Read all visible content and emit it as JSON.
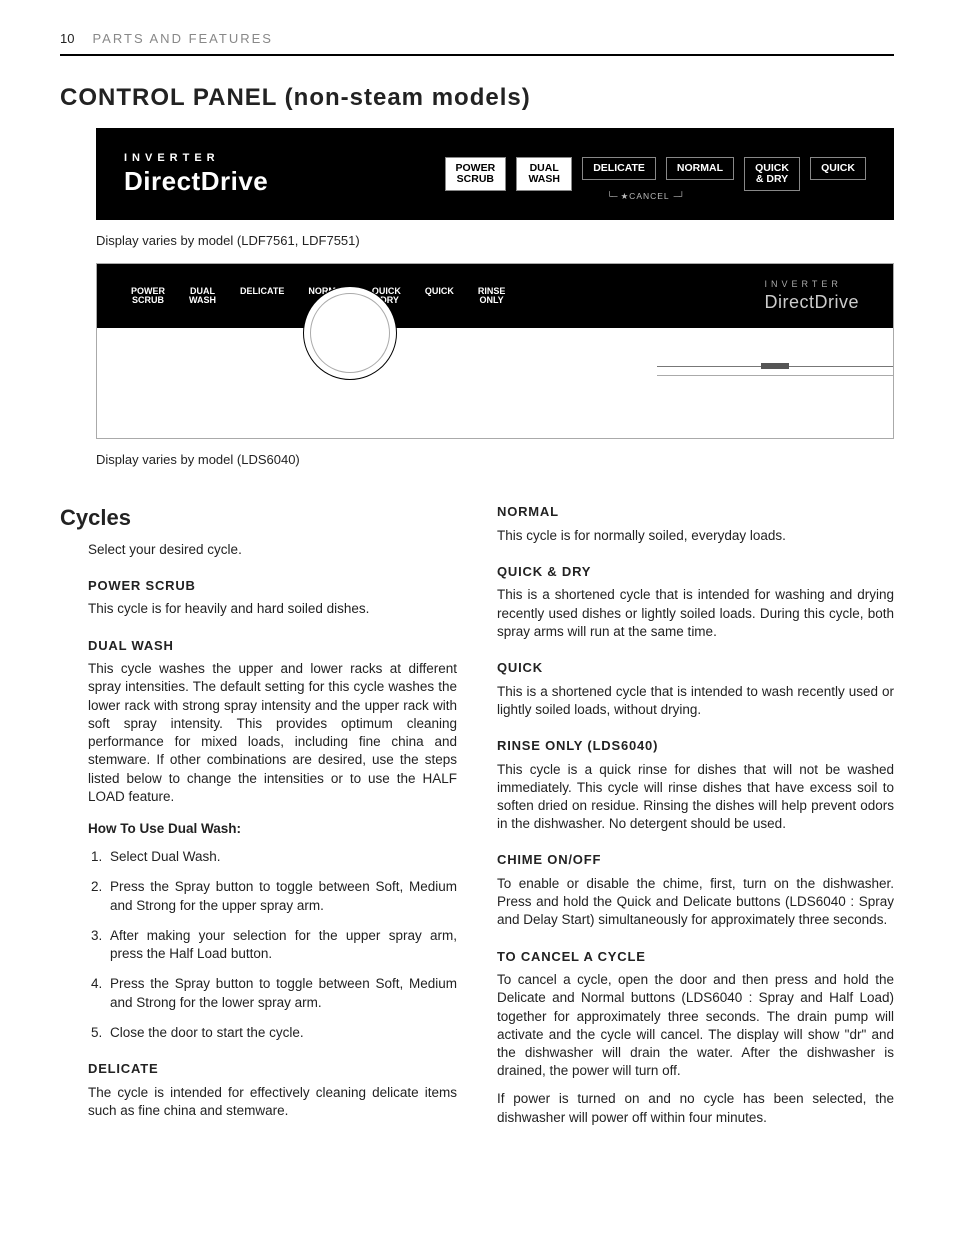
{
  "header": {
    "page": "10",
    "section": "PARTS AND FEATURES"
  },
  "title": "CONTROL PANEL (non-steam models)",
  "panel1": {
    "brand_top": "INVERTER",
    "brand_main": "DirectDrive",
    "buttons": {
      "b1a": "POWER",
      "b1b": "SCRUB",
      "b2a": "DUAL",
      "b2b": "WASH",
      "b3": "DELICATE",
      "b4": "NORMAL",
      "b5a": "QUICK",
      "b5b": "& DRY",
      "b6": "QUICK"
    },
    "cancel": "★CANCEL"
  },
  "caption1": "Display varies by model (LDF7561, LDF7551)",
  "panel2": {
    "labels": {
      "l1a": "POWER",
      "l1b": "SCRUB",
      "l2a": "DUAL",
      "l2b": "WASH",
      "l3": "DELICATE",
      "l4": "NORMAL",
      "l5a": "QUICK",
      "l5b": "&DRY",
      "l6": "QUICK",
      "l7a": "RINSE",
      "l7b": "ONLY"
    },
    "brand_top": "INVERTER",
    "brand_main": "DirectDrive"
  },
  "caption2": "Display varies by model (LDS6040)",
  "left": {
    "cycles_title": "Cycles",
    "intro": "Select your desired cycle.",
    "power_scrub_h": "POWER SCRUB",
    "power_scrub_p": "This cycle is for heavily and hard soiled dishes.",
    "dual_wash_h": "DUAL WASH",
    "dual_wash_p": "This cycle washes the upper and lower racks at different spray intensities. The default setting for this cycle washes the lower rack with strong spray intensity and the upper rack with soft spray intensity. This provides optimum cleaning performance for mixed loads, including fine china and stemware. If other combinations are desired, use the steps listed below to change the intensities or to use the HALF LOAD feature.",
    "howto_h": "How To Use Dual Wash:",
    "steps": {
      "s1": "Select Dual Wash.",
      "s2": "Press the Spray button to toggle between Soft, Medium and Strong for the upper spray arm.",
      "s3": "After making your selection for the upper spray arm, press the Half Load button.",
      "s4": "Press the Spray button to toggle between Soft, Medium and Strong for the lower spray arm.",
      "s5": "Close the door to start the cycle."
    },
    "delicate_h": "DELICATE",
    "delicate_p": "The cycle is intended for effectively cleaning delicate items such as fine china and stemware."
  },
  "right": {
    "normal_h": "NORMAL",
    "normal_p": "This cycle is for normally soiled, everyday loads.",
    "quickdry_h": "QUICK & DRY",
    "quickdry_p": "This is a shortened cycle that is intended for washing and drying recently used dishes or lightly soiled loads. During this cycle, both spray arms will run at the same time.",
    "quick_h": "QUICK",
    "quick_p": "This is a shortened cycle that is intended to wash recently used or lightly soiled loads, without drying.",
    "rinse_h": "RINSE ONLY (LDS6040)",
    "rinse_p": "This cycle is a quick rinse for dishes that will not be washed immediately. This cycle will rinse dishes that have excess soil to soften dried on residue. Rinsing the dishes will help prevent odors in the dishwasher. No detergent should be used.",
    "chime_h": "CHIME ON/OFF",
    "chime_p": "To enable or disable the chime, first, turn on the dishwasher. Press and hold the Quick and Delicate buttons (LDS6040 : Spray and Delay Start) simultaneously for approximately three seconds.",
    "cancel_h": "TO CANCEL A CYCLE",
    "cancel_p1": "To cancel a cycle, open the door and then press and hold the Delicate and Normal buttons (LDS6040 : Spray and Half Load) together for approximately three seconds. The drain pump will activate and the cycle will cancel. The display will show \"dr\" and the dishwasher will drain the water. After the dishwasher is drained, the power will turn off.",
    "cancel_p2": "If power is turned on and no cycle has been selected, the dishwasher will power off within four minutes."
  }
}
